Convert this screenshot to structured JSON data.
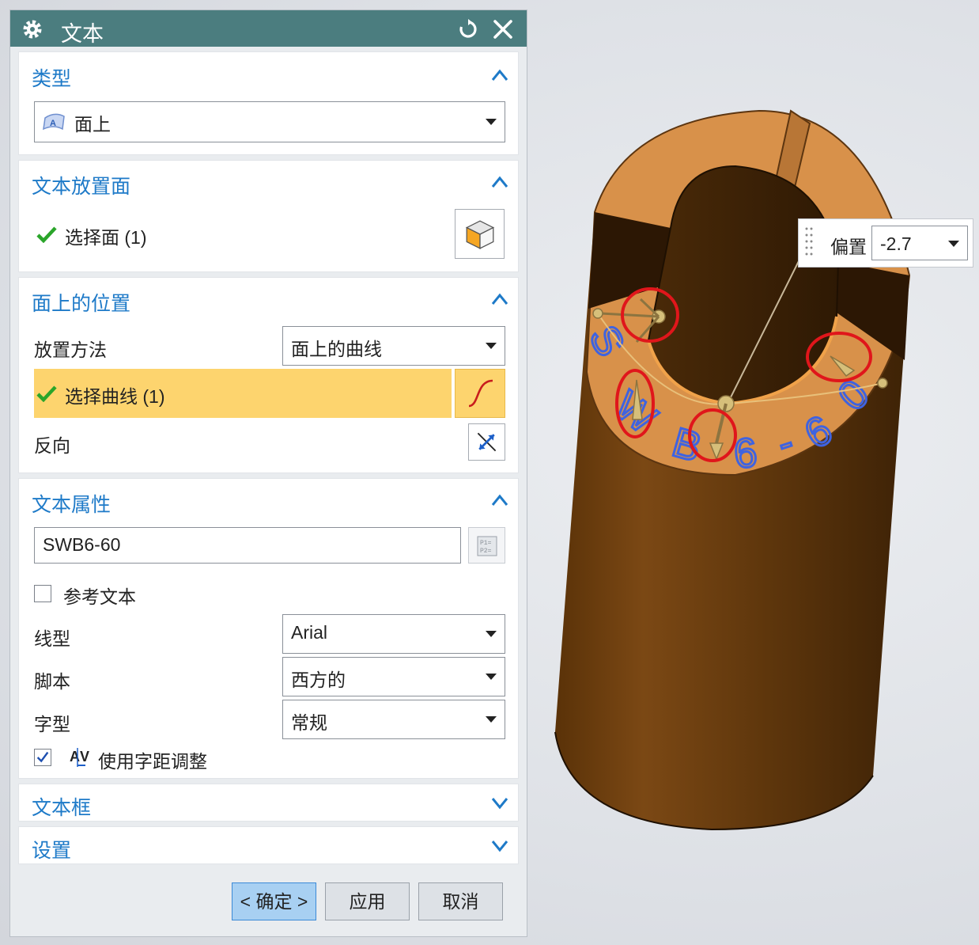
{
  "dialog": {
    "title": "文本",
    "type_section": {
      "title": "类型",
      "type_value": "面上"
    },
    "placement_face_section": {
      "title": "文本放置面",
      "select_face_label": "选择面 (1)"
    },
    "face_position_section": {
      "title": "面上的位置",
      "placement_method_label": "放置方法",
      "placement_method_value": "面上的曲线",
      "select_curve_label": "选择曲线 (1)",
      "reverse_label": "反向"
    },
    "text_properties_section": {
      "title": "文本属性",
      "text_value": "SWB6-60",
      "reference_text_label": "参考文本",
      "reference_text_checked": false,
      "font_label": "线型",
      "font_value": "Arial",
      "script_label": "脚本",
      "script_value": "西方的",
      "style_label": "字型",
      "style_value": "常规",
      "kerning_label": "使用字距调整",
      "kerning_checked": true
    },
    "text_frame_section": {
      "title": "文本框"
    },
    "settings_section": {
      "title": "设置"
    },
    "buttons": {
      "ok": "< 确定 >",
      "apply": "应用",
      "cancel": "取消"
    }
  },
  "viewport": {
    "offset_label": "偏置",
    "offset_value": "-2.7",
    "model_text": [
      "S",
      "W",
      "B",
      "6",
      "-",
      "6",
      "0"
    ]
  },
  "colors": {
    "title_bar": "#4b7d7f",
    "section_title": "#1e7ac8",
    "highlight_row": "#fdd46e",
    "ok_button": "#a8d0f2",
    "model_face": "#d8914a",
    "model_body": "#6b3f10",
    "engraved_text": "#3f63e0",
    "annotation_circle": "#e0161b"
  }
}
